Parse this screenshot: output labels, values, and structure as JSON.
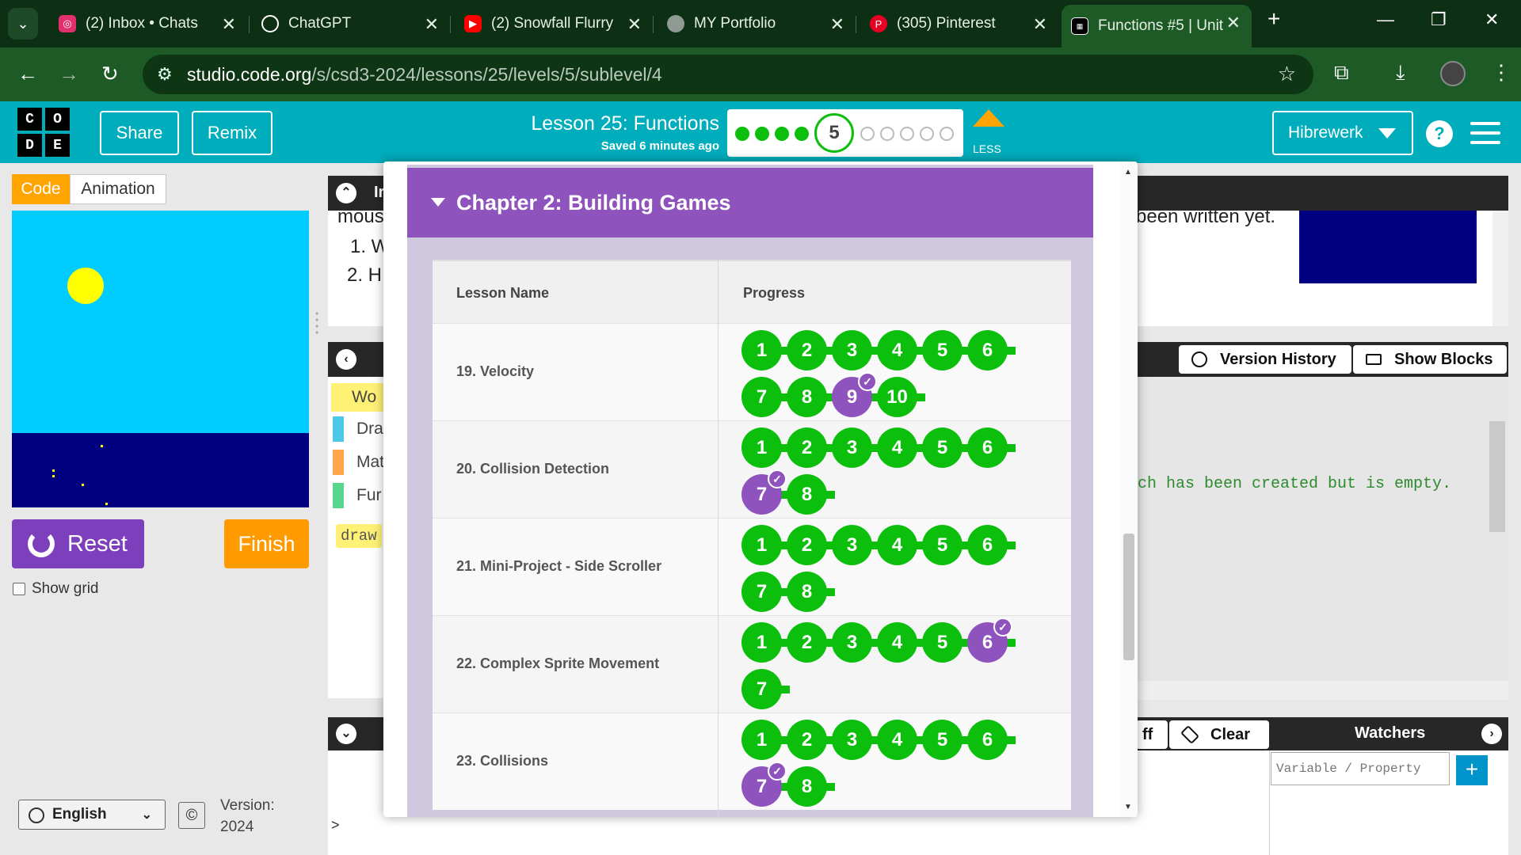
{
  "browser": {
    "tabs": [
      {
        "label": "(2) Inbox • Chats",
        "icon": "instagram-icon",
        "color": "#e1306c"
      },
      {
        "label": "ChatGPT",
        "icon": "chatgpt-icon",
        "color": "#ffffff"
      },
      {
        "label": "(2) Snowfall Flurry",
        "icon": "youtube-icon",
        "color": "#ff0000"
      },
      {
        "label": "MY Portfolio",
        "icon": "globe-icon",
        "color": "#9aa"
      },
      {
        "label": "(305) Pinterest",
        "icon": "pinterest-icon",
        "color": "#e60023"
      },
      {
        "label": "Functions #5 | Unit",
        "icon": "code-org-icon",
        "color": "#ffffff"
      }
    ],
    "new_tab": "+",
    "address": {
      "host": "studio.code.org",
      "path": "/s/csd3-2024/lessons/25/levels/5/sublevel/4"
    }
  },
  "header": {
    "logo_letters": [
      "C",
      "O",
      "D",
      "E"
    ],
    "share": "Share",
    "remix": "Remix",
    "lesson_title": "Lesson 25: Functions",
    "saved_status": "Saved 6 minutes ago",
    "current_level": "5",
    "completed_levels": 4,
    "remaining_levels": 5,
    "less_label": "LESS",
    "user": "Hibrewerk",
    "help": "?"
  },
  "left_pane": {
    "tabs": [
      "Code",
      "Animation"
    ],
    "reset": "Reset",
    "finish": "Finish",
    "show_grid": "Show grid",
    "language": "English",
    "copyright": "©",
    "version_label": "Version:",
    "version_value": "2024"
  },
  "workspace": {
    "instructions_fragment": "Ir",
    "instr_text_1": "mous",
    "instr_text_2": "been written yet.",
    "list_1": "1. W",
    "list_2": "2. H",
    "version_history": "Version History",
    "show_blocks": "Show Blocks",
    "palette": [
      {
        "label": "Wo",
        "color": "#fff176"
      },
      {
        "label": "Dra",
        "color": "#4dc8e8"
      },
      {
        "label": "Mat",
        "color": "#ffa64d"
      },
      {
        "label": "Fur",
        "color": "#57d68d"
      }
    ],
    "code_fragment": "draw",
    "code_comment": "ch has been created but is empty.",
    "console_off": "ff",
    "clear": "Clear",
    "watchers": "Watchers",
    "watch_placeholder": "Variable / Property",
    "watch_add": "+",
    "console_caret": ">"
  },
  "overlay": {
    "chapter": "Chapter 2: Building Games",
    "col_lesson": "Lesson Name",
    "col_progress": "Progress",
    "lessons": [
      {
        "name": "19. Velocity",
        "levels": [
          "1",
          "2",
          "3",
          "4",
          "5",
          "6",
          "7",
          "8",
          "9",
          "10"
        ],
        "completed": [
          "9"
        ]
      },
      {
        "name": "20. Collision Detection",
        "levels": [
          "1",
          "2",
          "3",
          "4",
          "5",
          "6",
          "7",
          "8"
        ],
        "completed": [
          "7"
        ]
      },
      {
        "name": "21. Mini-Project - Side Scroller",
        "levels": [
          "1",
          "2",
          "3",
          "4",
          "5",
          "6",
          "7",
          "8"
        ],
        "completed": []
      },
      {
        "name": "22. Complex Sprite Movement",
        "levels": [
          "1",
          "2",
          "3",
          "4",
          "5",
          "6",
          "7"
        ],
        "completed": [
          "6"
        ]
      },
      {
        "name": "23. Collisions",
        "levels": [
          "1",
          "2",
          "3",
          "4",
          "5",
          "6",
          "7",
          "8"
        ],
        "completed": [
          "7"
        ]
      }
    ]
  },
  "colors": {
    "accent_teal": "#00adbc",
    "progress_green": "#0cbf0c",
    "chapter_purple": "#8f53bd",
    "finish_orange": "#ff9a00"
  }
}
